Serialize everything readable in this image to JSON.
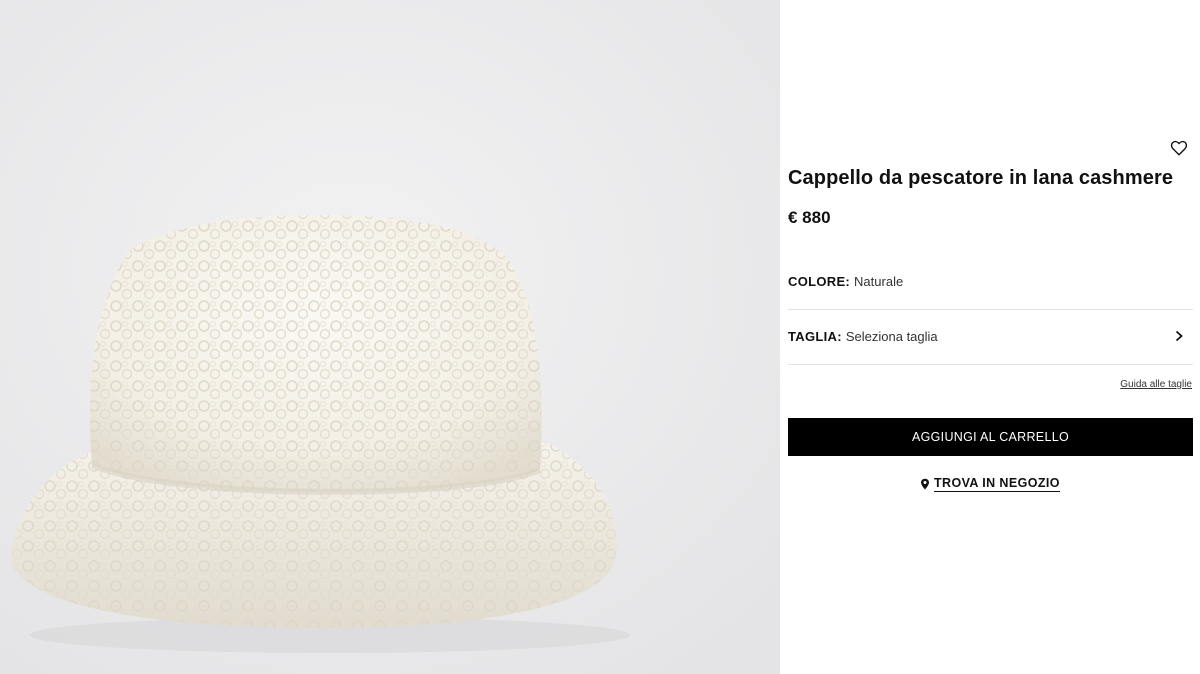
{
  "product": {
    "title": "Cappello da pescatore in lana cashmere",
    "price": "€ 880",
    "image_alt": "bucket-hat-photo"
  },
  "color": {
    "label": "COLORE:",
    "value": "Naturale"
  },
  "size": {
    "label": "TAGLIA:",
    "value": "Seleziona taglia"
  },
  "size_guide": "Guida alle taglie",
  "cart_button": "AGGIUNGI AL CARRELLO",
  "store_link": "TROVA IN NEGOZIO",
  "colors": {
    "accent": "#000000",
    "background": "#ebebed",
    "hat": "#f7f4ee"
  }
}
